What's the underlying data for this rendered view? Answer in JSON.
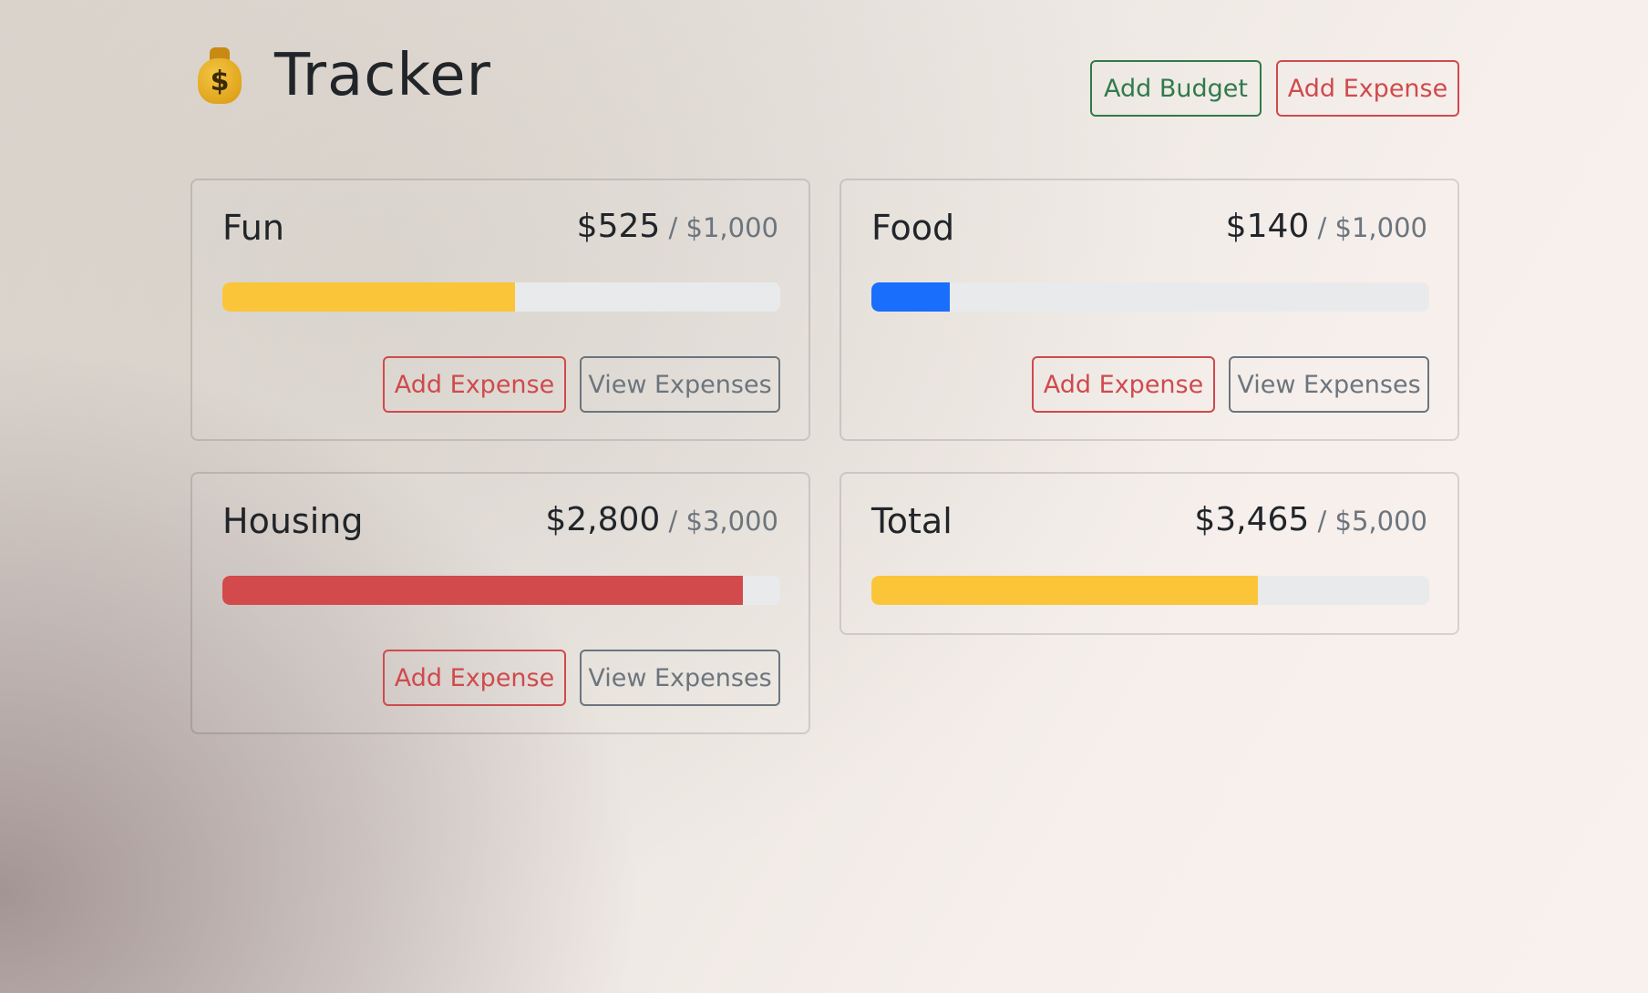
{
  "header": {
    "title": "Tracker",
    "icon": "money-bag-icon",
    "add_budget_label": "Add Budget",
    "add_expense_label": "Add Expense"
  },
  "budgets": [
    {
      "name": "Fun",
      "spent": "$525",
      "max": "$1,000",
      "progress_percent": 52.5,
      "bar_color": "#fbc53a",
      "add_expense_label": "Add Expense",
      "view_expenses_label": "View Expenses"
    },
    {
      "name": "Food",
      "spent": "$140",
      "max": "$1,000",
      "progress_percent": 14,
      "bar_color": "#1a6efc",
      "add_expense_label": "Add Expense",
      "view_expenses_label": "View Expenses"
    },
    {
      "name": "Housing",
      "spent": "$2,800",
      "max": "$3,000",
      "progress_percent": 93.3,
      "bar_color": "#d24a4b",
      "add_expense_label": "Add Expense",
      "view_expenses_label": "View Expenses"
    }
  ],
  "total": {
    "name": "Total",
    "spent": "$3,465",
    "max": "$5,000",
    "progress_percent": 69.3,
    "bar_color": "#fbc53a"
  },
  "colors": {
    "green": "#2f7a4b",
    "red": "#cf4a4d",
    "gray": "#6c757d",
    "track": "#e9eaec"
  }
}
